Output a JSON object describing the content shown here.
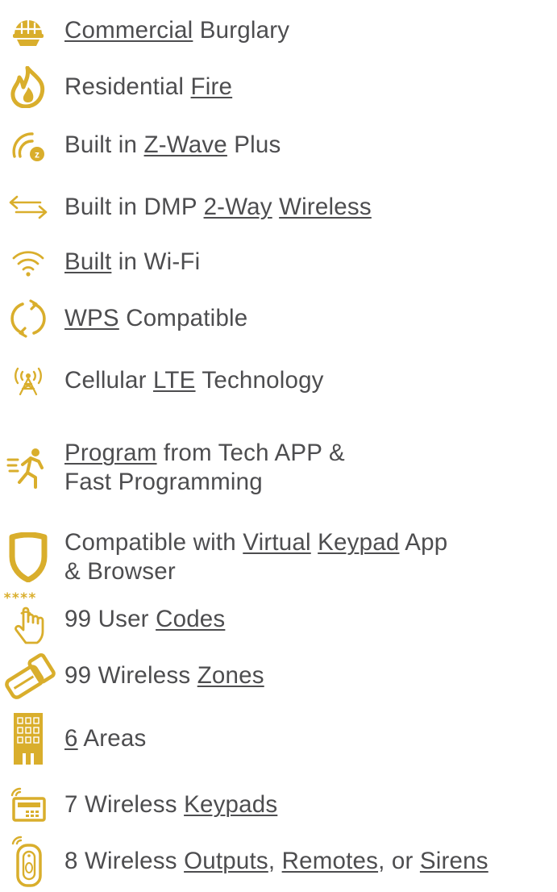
{
  "colors": {
    "accent": "#d9ae2c",
    "text": "#4d4d4f"
  },
  "features": [
    {
      "icon": "helmet-icon",
      "parts": [
        {
          "t": "Commercial",
          "u": true
        },
        {
          "t": " Burglary",
          "u": false
        }
      ]
    },
    {
      "icon": "flame-icon",
      "parts": [
        {
          "t": "Residential ",
          "u": false
        },
        {
          "t": "Fire",
          "u": true
        }
      ]
    },
    {
      "icon": "z-wave-icon",
      "parts": [
        {
          "t": "Built in ",
          "u": false
        },
        {
          "t": "Z-Wave",
          "u": true
        },
        {
          "t": " Plus",
          "u": false
        }
      ]
    },
    {
      "icon": "two-way-arrows-icon",
      "parts": [
        {
          "t": "Built in DMP ",
          "u": false
        },
        {
          "t": "2-Way",
          "u": true
        },
        {
          "t": " ",
          "u": false
        },
        {
          "t": "Wireless",
          "u": true
        }
      ]
    },
    {
      "icon": "wifi-icon",
      "parts": [
        {
          "t": "Built",
          "u": true
        },
        {
          "t": " in Wi-Fi",
          "u": false
        }
      ]
    },
    {
      "icon": "refresh-circle-icon",
      "parts": [
        {
          "t": "WPS",
          "u": true
        },
        {
          "t": " Compatible",
          "u": false
        }
      ]
    },
    {
      "icon": "cell-tower-icon",
      "parts": [
        {
          "t": "Cellular ",
          "u": false
        },
        {
          "t": "LTE",
          "u": true
        },
        {
          "t": " Technology",
          "u": false
        }
      ]
    },
    {
      "icon": "running-person-icon",
      "lines": [
        [
          {
            "t": "Program",
            "u": true
          },
          {
            "t": " from Tech APP &",
            "u": false
          }
        ],
        [
          {
            "t": "Fast Programming",
            "u": false
          }
        ]
      ]
    },
    {
      "icon": "shield-icon",
      "lines": [
        [
          {
            "t": "Compatible with ",
            "u": false
          },
          {
            "t": "Virtual",
            "u": true
          },
          {
            "t": " ",
            "u": false
          },
          {
            "t": "Keypad",
            "u": true
          },
          {
            "t": " App",
            "u": false
          }
        ],
        [
          {
            "t": "& Browser",
            "u": false
          }
        ]
      ]
    },
    {
      "icon": "touch-code-icon",
      "icon_text": "****",
      "parts": [
        {
          "t": "99 User ",
          "u": false
        },
        {
          "t": "Codes",
          "u": true
        }
      ]
    },
    {
      "icon": "wireless-sensor-icon",
      "parts": [
        {
          "t": "99 Wireless ",
          "u": false
        },
        {
          "t": "Zones",
          "u": true
        }
      ]
    },
    {
      "icon": "building-icon",
      "parts": [
        {
          "t": "6",
          "u": true
        },
        {
          "t": " Areas",
          "u": false
        }
      ]
    },
    {
      "icon": "wireless-keypad-icon",
      "parts": [
        {
          "t": "7 Wireless ",
          "u": false
        },
        {
          "t": "Keypads",
          "u": true
        }
      ]
    },
    {
      "icon": "wireless-remote-icon",
      "parts": [
        {
          "t": "8 Wireless ",
          "u": false
        },
        {
          "t": "Outputs",
          "u": true
        },
        {
          "t": ", ",
          "u": false
        },
        {
          "t": "Remotes",
          "u": true
        },
        {
          "t": ", or ",
          "u": false
        },
        {
          "t": "Sirens",
          "u": true
        }
      ]
    }
  ]
}
